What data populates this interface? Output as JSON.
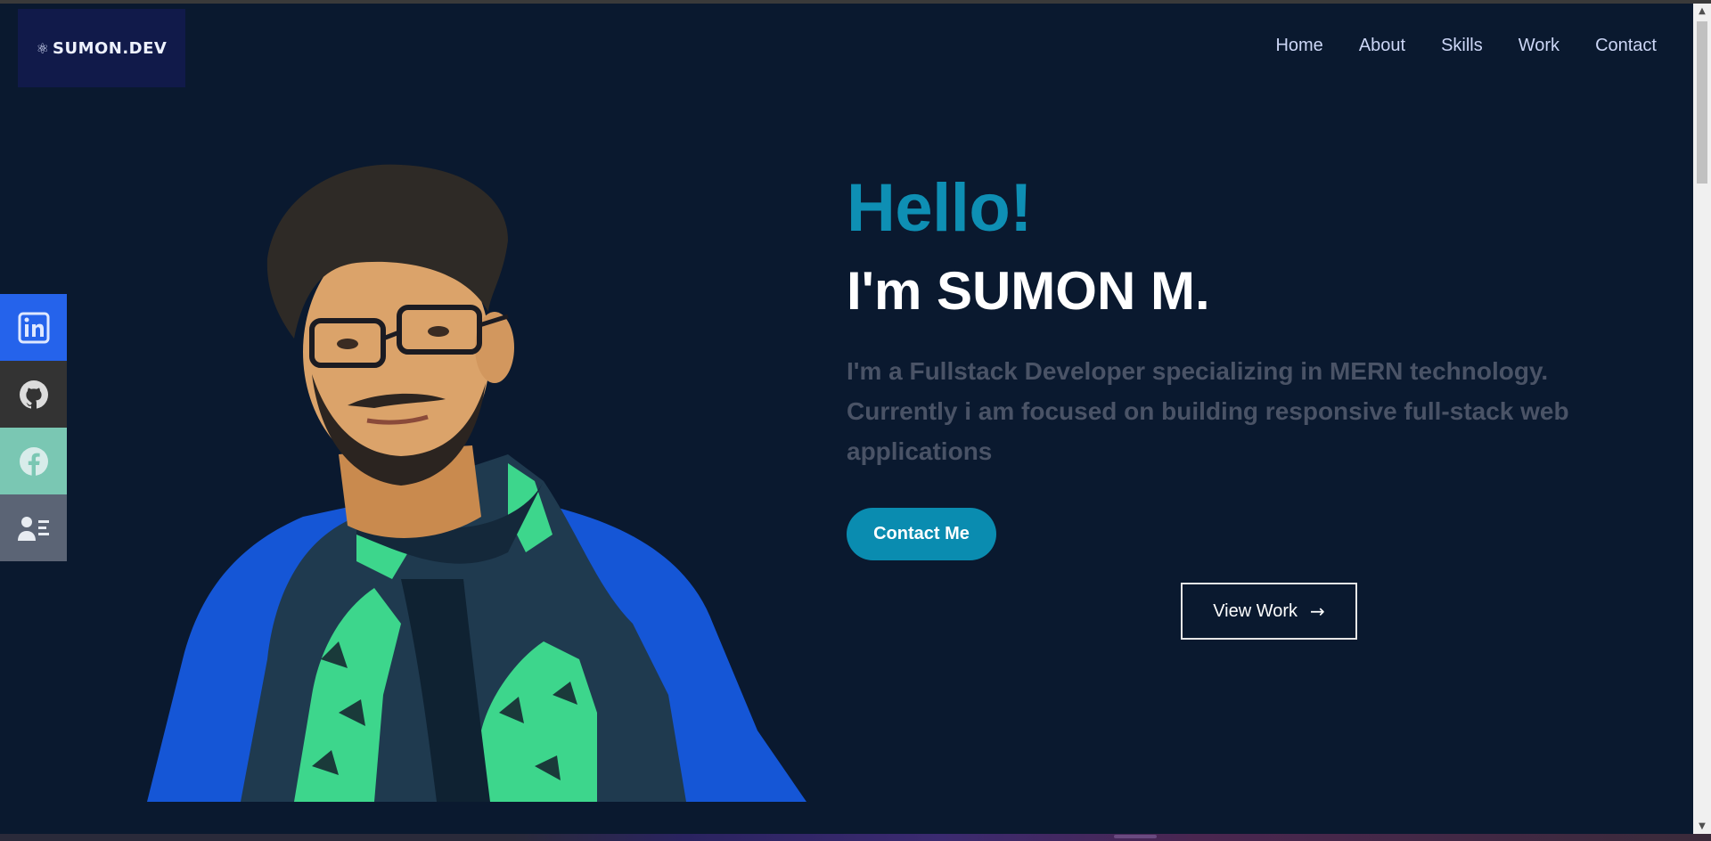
{
  "header": {
    "logo_text": "SUMON.DEV",
    "nav": [
      "Home",
      "About",
      "Skills",
      "Work",
      "Contact"
    ]
  },
  "social": {
    "items": [
      "linkedin-icon",
      "github-icon",
      "facebook-icon",
      "resume-icon"
    ]
  },
  "hero": {
    "greeting": "Hello!",
    "name": "I'm SUMON M.",
    "description": "I'm a Fullstack Developer specializing in MERN technology. Currently i am focused on building responsive full-stack web applications",
    "contact_button": "Contact Me",
    "work_button": "View Work"
  },
  "colors": {
    "background": "#0a192f",
    "accent": "#0e8fb4",
    "linkedin": "#2563eb",
    "github": "#333333",
    "facebook": "#7ac7b3",
    "resume": "#5b6475"
  }
}
